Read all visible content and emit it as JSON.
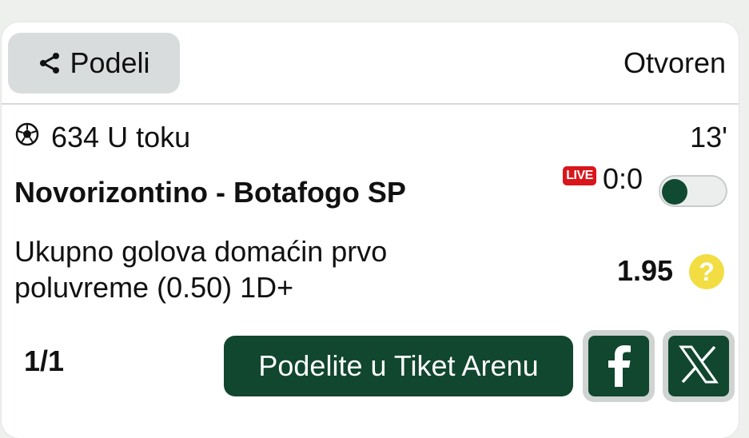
{
  "header": {
    "share_label": "Podeli",
    "status": "Otvoren"
  },
  "match": {
    "code_status": "634 U toku",
    "minute": "13'",
    "teams": "Novorizontino - Botafogo SP",
    "live_badge": "LIVE",
    "score": "0:0",
    "toggle_on": false
  },
  "bet": {
    "market": "Ukupno golova domaćin prvo poluvreme (0.50) 1D+",
    "odds": "1.95",
    "help": "?"
  },
  "footer": {
    "counter": "1/1",
    "arena_button": "Podelite u Tiket Arenu"
  },
  "icons": {
    "share": "share-icon",
    "sport": "soccer-ball-icon",
    "help": "question-icon",
    "facebook": "facebook-icon",
    "x": "x-icon"
  },
  "colors": {
    "primary": "#11462f",
    "live": "#d8161b",
    "help": "#f2dd43",
    "secondary_button": "#d9dcdd"
  }
}
